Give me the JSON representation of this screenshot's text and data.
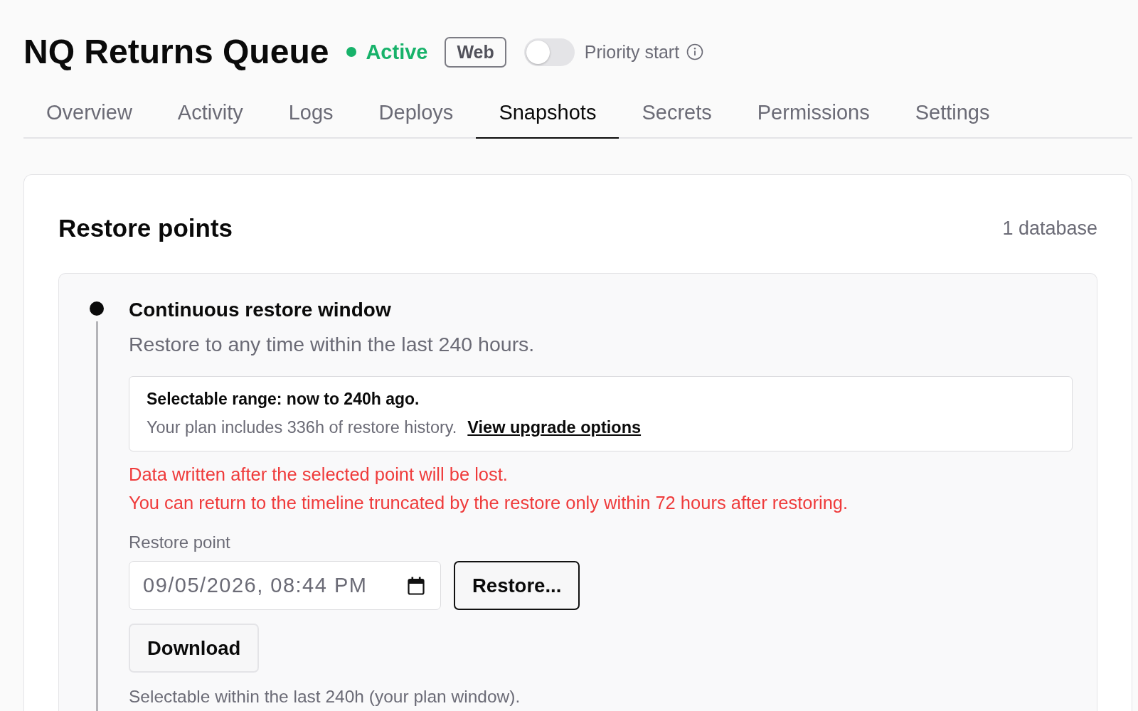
{
  "header": {
    "title": "NQ Returns Queue",
    "status": {
      "label": "Active",
      "kind": "active"
    },
    "badge": "Web",
    "priority_toggle": {
      "label": "Priority start",
      "on": false
    }
  },
  "tabs": [
    {
      "label": "Overview",
      "selected": false
    },
    {
      "label": "Activity",
      "selected": false
    },
    {
      "label": "Logs",
      "selected": false
    },
    {
      "label": "Deploys",
      "selected": false
    },
    {
      "label": "Snapshots",
      "selected": true
    },
    {
      "label": "Secrets",
      "selected": false
    },
    {
      "label": "Permissions",
      "selected": false
    },
    {
      "label": "Settings",
      "selected": false
    }
  ],
  "restore_points": {
    "title": "Restore points",
    "count": "1 database",
    "window": {
      "title": "Continuous restore window",
      "description": "Restore to any time within the last 240 hours.",
      "notice": {
        "heading": "Selectable range: now to 240h ago.",
        "text": "Your plan includes 336h of restore history.",
        "link": "View upgrade options"
      },
      "warnings": [
        "Data written after the selected point will be lost.",
        "You can return to the timeline truncated by the restore only within 72 hours after restoring."
      ],
      "restore_point": {
        "label": "Restore point",
        "value": "09/05/2026, 08:44 PM"
      },
      "restore_button": "Restore...",
      "download_button": "Download",
      "hint": "Selectable within the last 240h (your plan window)."
    }
  }
}
